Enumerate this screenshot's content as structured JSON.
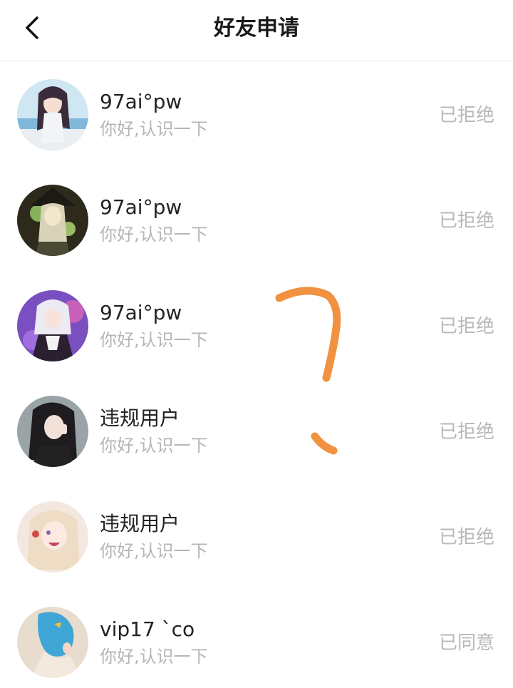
{
  "header": {
    "title": "好友申请",
    "back_icon": "chevron-left-icon"
  },
  "requests": [
    {
      "name": "97ai°pw",
      "message": "你好,认识一下",
      "status": "已拒绝",
      "avatar": "anime-girl-beach"
    },
    {
      "name": "97ai°pw",
      "message": "你好,认识一下",
      "status": "已拒绝",
      "avatar": "anime-witch-glow"
    },
    {
      "name": "97ai°pw",
      "message": "你好,认识一下",
      "status": "已拒绝",
      "avatar": "anime-white-hair-purple"
    },
    {
      "name": "违规用户",
      "message": "你好,认识一下",
      "status": "已拒绝",
      "avatar": "anime-dark-hair-wink"
    },
    {
      "name": "违规用户",
      "message": "你好,认识一下",
      "status": "已拒绝",
      "avatar": "anime-blonde-smile"
    },
    {
      "name": "vip17 `co",
      "message": "你好,认识一下",
      "status": "已同意",
      "avatar": "blue-hair-back"
    }
  ],
  "colors": {
    "status_text": "#b8b8b8",
    "message_text": "#b5b5b5",
    "annotation_stroke": "#f0923f"
  }
}
